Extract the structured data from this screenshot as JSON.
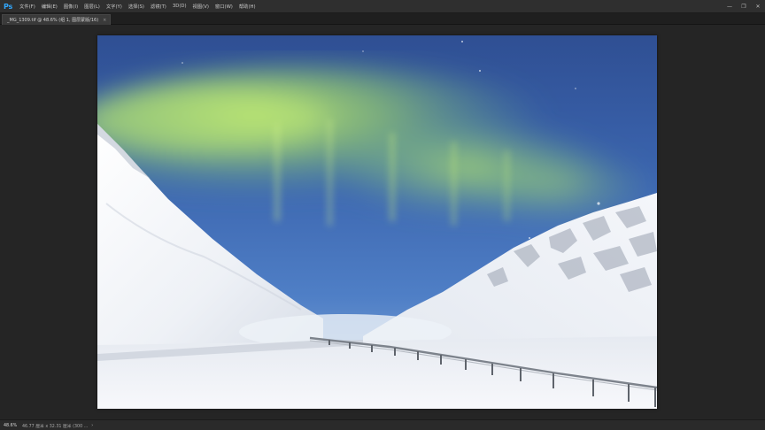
{
  "app": {
    "logo": "Ps"
  },
  "menu": [
    "文件(F)",
    "编辑(E)",
    "图像(I)",
    "图层(L)",
    "文字(Y)",
    "选择(S)",
    "滤镜(T)",
    "3D(D)",
    "视图(V)",
    "窗口(W)",
    "帮助(H)"
  ],
  "window_controls": {
    "minimize": "—",
    "restore": "❐",
    "close": "✕"
  },
  "tab": {
    "title": "_MG_1309.tif @ 48.6% (组 1, 图层蒙版/16)",
    "close": "×"
  },
  "status": {
    "zoom": "48.6%",
    "doc_info": "46.77 厘米 x 32.31 厘米 (300 ...",
    "arrow": "›"
  },
  "colors": {
    "accent": "#31a8ff",
    "workspace_bg": "#262626",
    "menubar_bg": "#2f2f2f"
  }
}
